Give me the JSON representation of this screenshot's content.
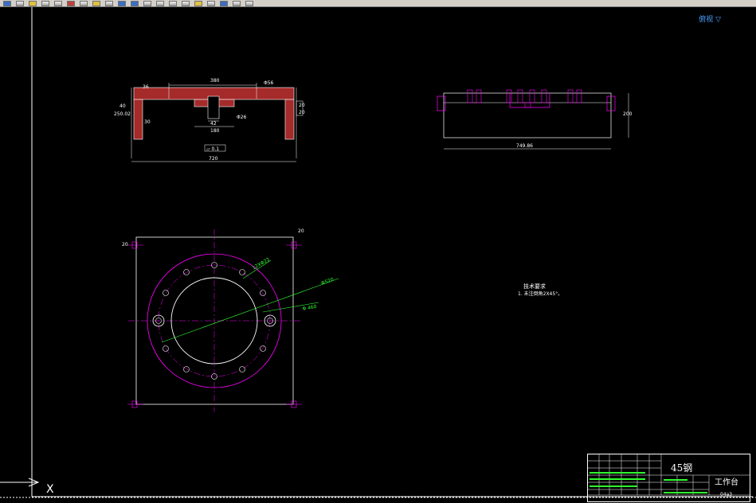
{
  "view_label": "俯视 ▽",
  "notes": {
    "title": "技术要求",
    "text": "1. 未注倒角2X45°。"
  },
  "dims": {
    "top_width": "380",
    "top_small": "36",
    "top_hole": "Φ56",
    "left_h": "40",
    "left_h2": "250.02",
    "inner_a": "30",
    "slot_w": "42",
    "slot_w2": "180",
    "slot_h": "Φ26",
    "right_h": "20",
    "right_h2": "20",
    "flatness": "⏥ 0.1",
    "overall": "720",
    "side_height": "200",
    "side_width": "749.86",
    "hole_callout": "12XΦ22",
    "dia_big": "Φ520",
    "dia_pcd": "Φ 460",
    "corner_left": "20",
    "corner_right": "20"
  },
  "ucs": {
    "x_label": "X"
  },
  "title_block": {
    "material": "45钢",
    "part_name": "工作台",
    "code": "04a3"
  },
  "colors": {
    "white": "#ffffff",
    "magenta": "#ff00ff",
    "green": "#30ff30",
    "hatch": "#a52a2a",
    "bg": "#000000"
  }
}
